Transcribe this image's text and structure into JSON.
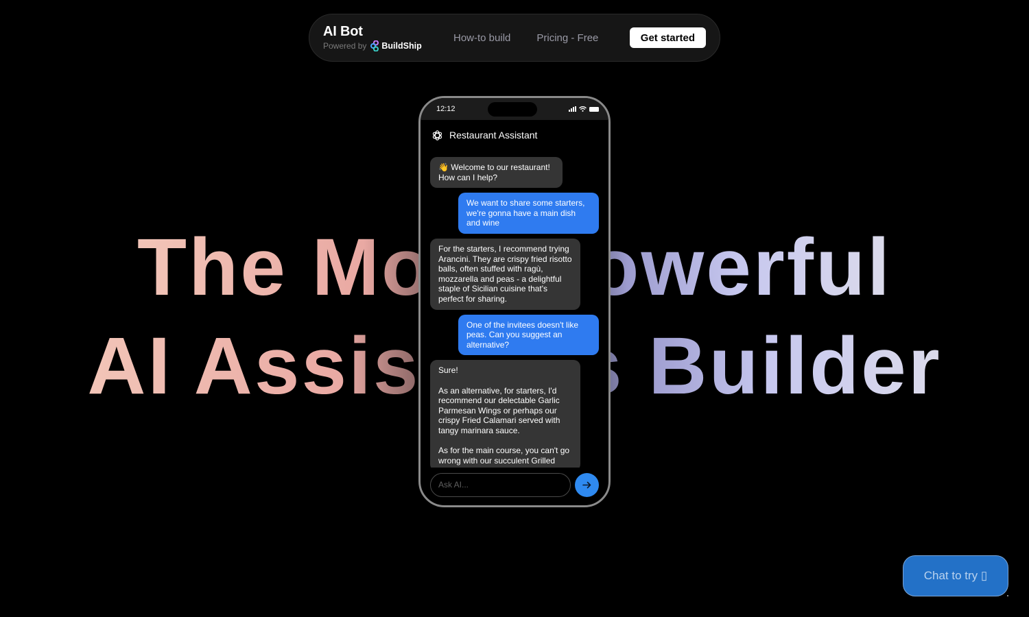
{
  "nav": {
    "brand_title": "AI Bot",
    "powered_by": "Powered by",
    "powered_brand": "BuildShip",
    "links": [
      "How-to build",
      "Pricing - Free"
    ],
    "cta": "Get started"
  },
  "hero": {
    "line1": "The Most Powerful",
    "line2": "AI Assistants Builder"
  },
  "phone": {
    "time": "12:12",
    "assistant_title": "Restaurant Assistant",
    "messages": [
      {
        "role": "bot",
        "text": "👋 Welcome to our restaurant!\nHow can I help?"
      },
      {
        "role": "user",
        "text": "We want to share some starters, we're gonna have a main dish and wine"
      },
      {
        "role": "bot",
        "text": "For the starters, I recommend trying Arancini. They are crispy fried risotto balls, often stuffed with ragù, mozzarella and peas - a delightful staple of Sicilian cuisine that's perfect for sharing."
      },
      {
        "role": "user",
        "text": "One of the invitees doesn't like peas. Can you suggest an alternative?"
      },
      {
        "role": "bot",
        "text": "Sure!\n\nAs an alternative, for starters, I'd recommend our delectable Garlic Parmesan Wings or perhaps our crispy Fried Calamari served with tangy marinara sauce.\n\nAs for the main course, you can't go wrong with our succulent Grilled"
      }
    ],
    "input_placeholder": "Ask AI...",
    "send_icon": "arrow-right-icon"
  },
  "chat_button": {
    "label": "Chat to try ▯"
  },
  "colors": {
    "background": "#000000",
    "user_bubble": "#2f7bf0",
    "bot_bubble": "#353535",
    "send_button": "#2f8af0",
    "chat_button": "#2371c7"
  }
}
